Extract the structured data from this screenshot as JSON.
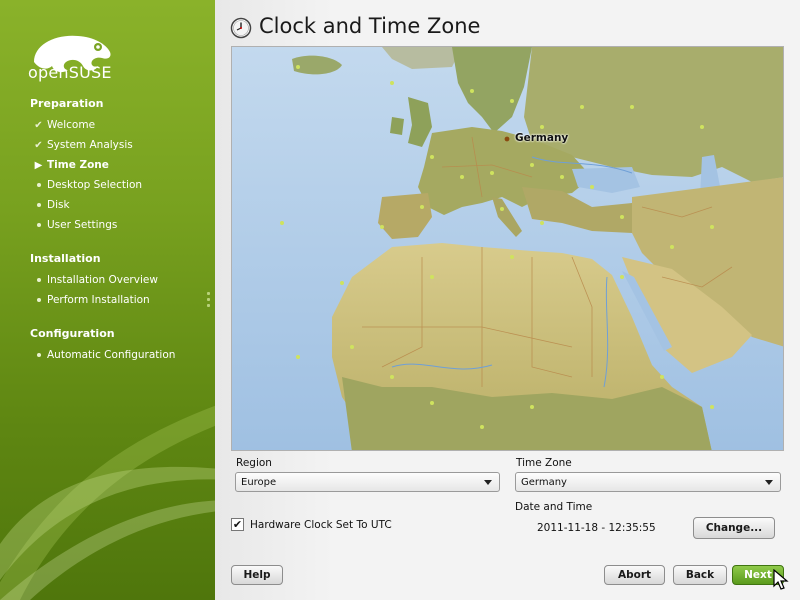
{
  "sidebar": {
    "logo_text": "openSUSE",
    "sections": [
      {
        "title": "Preparation",
        "steps": [
          {
            "label": "Welcome",
            "state": "done"
          },
          {
            "label": "System Analysis",
            "state": "done"
          },
          {
            "label": "Time Zone",
            "state": "current"
          },
          {
            "label": "Desktop Selection",
            "state": "pending"
          },
          {
            "label": "Disk",
            "state": "pending"
          },
          {
            "label": "User Settings",
            "state": "pending"
          }
        ]
      },
      {
        "title": "Installation",
        "steps": [
          {
            "label": "Installation Overview",
            "state": "pending"
          },
          {
            "label": "Perform Installation",
            "state": "pending"
          }
        ]
      },
      {
        "title": "Configuration",
        "steps": [
          {
            "label": "Automatic Configuration",
            "state": "pending"
          }
        ]
      }
    ]
  },
  "header": {
    "title": "Clock and Time Zone",
    "icon": "clock-icon"
  },
  "map": {
    "selected_label": "Germany"
  },
  "region": {
    "label": "Region",
    "value": "Europe"
  },
  "timezone": {
    "label": "Time Zone",
    "value": "Germany"
  },
  "datetime": {
    "label": "Date and Time",
    "value": "2011-11-18 - 12:35:55"
  },
  "hwclock": {
    "label": "Hardware Clock Set To UTC",
    "checked": true
  },
  "buttons": {
    "change": "Change...",
    "help": "Help",
    "abort": "Abort",
    "back": "Back",
    "next": "Next"
  },
  "colors": {
    "accent": "#6f9a1b",
    "sea": "#a8c8e6",
    "land": "#b5b06b",
    "desert": "#d3c58a"
  }
}
